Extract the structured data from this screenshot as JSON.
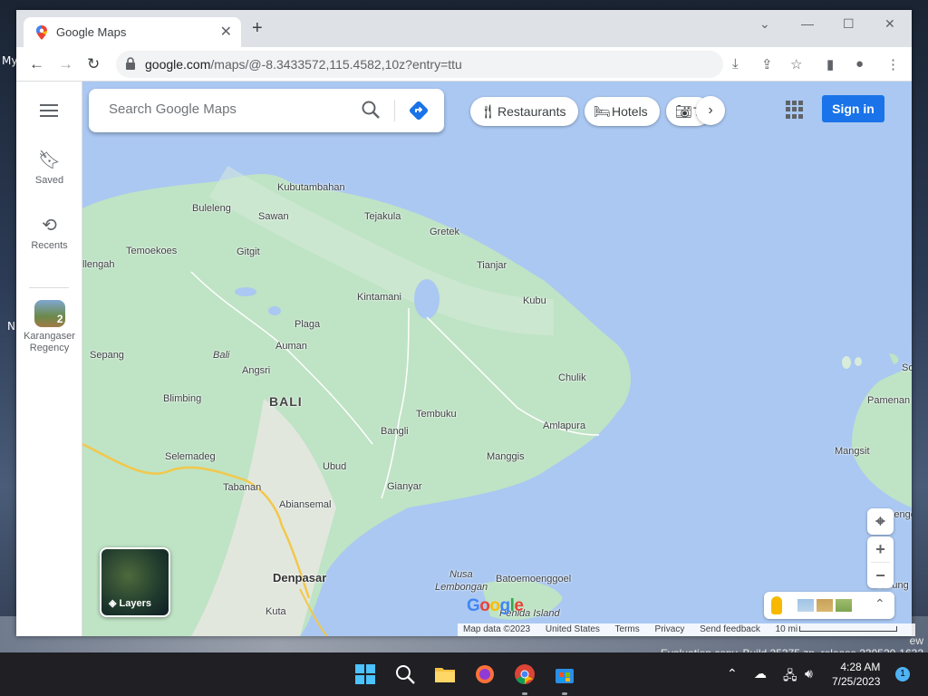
{
  "browser": {
    "tab_title": "Google Maps",
    "url_host": "google.com",
    "url_path": "/maps/@-8.3433572,115.4582,10z?entry=ttu"
  },
  "rail": {
    "saved_label": "Saved",
    "recents_label": "Recents",
    "recent_place_label": "Karangaser Regency",
    "recent_place_count": "2"
  },
  "search": {
    "placeholder": "Search Google Maps"
  },
  "chips": [
    {
      "label": "Restaurants"
    },
    {
      "label": "Hotels"
    },
    {
      "label": "T"
    }
  ],
  "signin_label": "Sign in",
  "layers_label": "Layers",
  "map": {
    "places": [
      "Kubutambahan",
      "Buleleng",
      "Sawan",
      "Tejakula",
      "Temoekoes",
      "Gitgit",
      "Gretek",
      "llengah",
      "Tianjar",
      "Kintamani",
      "Kubu",
      "Plaga",
      "Sepang",
      "Auman",
      "Bali",
      "Angsri",
      "Chulik",
      "BALI",
      "Blimbing",
      "Tembuku",
      "Amlapura",
      "Bangli",
      "Selemadeg",
      "Manggis",
      "Ubud",
      "Gianyar",
      "Tabanan",
      "Abiansemal",
      "Denpasar",
      "Nusa",
      "Lembongan",
      "Batoemoenggoel",
      "Penida Island",
      "Kuta",
      "Pamenan",
      "Mangsit",
      "Sengg",
      "So",
      "Gerung"
    ]
  },
  "footer": {
    "map_data": "Map data ©2023",
    "country": "United States",
    "terms": "Terms",
    "privacy": "Privacy",
    "feedback": "Send feedback",
    "scale": "10 mi"
  },
  "google_logo": "Google",
  "watermark": {
    "line1": "ew",
    "line2": "Evaluation copy. Build 25375.zn_release.230520-1632"
  },
  "desktop_labels": [
    "My",
    "N"
  ],
  "taskbar": {
    "time": "4:28 AM",
    "date": "7/25/2023",
    "notifications": "1"
  },
  "colors": {
    "water": "#aac8f2",
    "land": "#bfe3c5",
    "accent": "#1a73e8"
  }
}
